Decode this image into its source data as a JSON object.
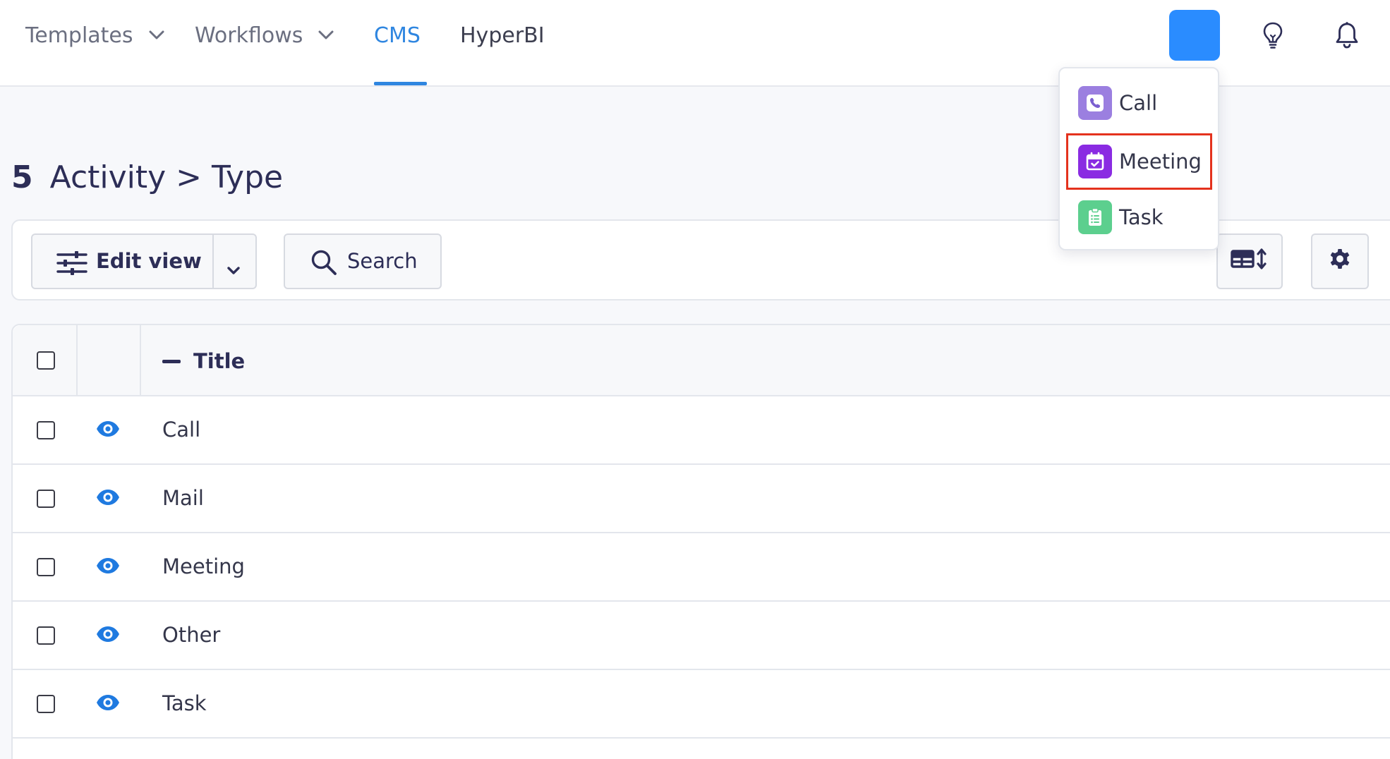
{
  "nav": {
    "items": [
      {
        "label": "Templates",
        "dropdown": true
      },
      {
        "label": "Workflows",
        "dropdown": true
      },
      {
        "label": "CMS",
        "active": true
      },
      {
        "label": "HyperBI"
      }
    ]
  },
  "header_icons": [
    "lightbulb-icon",
    "bell-icon"
  ],
  "page": {
    "count": "5",
    "title": "Activity > Type"
  },
  "toolbar": {
    "edit_view_label": "Edit view",
    "search_label": "Search"
  },
  "table": {
    "columns": [
      "Title"
    ],
    "rows": [
      {
        "title": "Call"
      },
      {
        "title": "Mail"
      },
      {
        "title": "Meeting"
      },
      {
        "title": "Other"
      },
      {
        "title": "Task"
      }
    ]
  },
  "dropdown": {
    "items": [
      {
        "label": "Call",
        "icon": "phone-icon",
        "color": "#9b7fe0"
      },
      {
        "label": "Meeting",
        "icon": "calendar-check-icon",
        "color": "#8a2be2",
        "highlighted": true
      },
      {
        "label": "Task",
        "icon": "clipboard-list-icon",
        "color": "#5ccf8e"
      }
    ]
  },
  "colors": {
    "accent": "#2f86e0",
    "primary_button": "#2a8cff",
    "eye_icon": "#1f7ae0",
    "highlight_border": "#e4321d"
  }
}
